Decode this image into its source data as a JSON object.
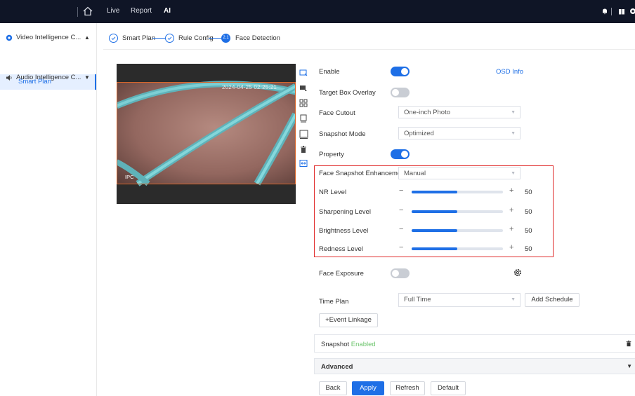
{
  "topbar": {
    "nav": [
      "Live",
      "Report",
      "AI"
    ],
    "active_nav": "AI",
    "icons": [
      "home-icon",
      "bell-icon",
      "gift-icon",
      "settings-icon"
    ]
  },
  "sidebar": {
    "items": [
      {
        "label": "Video Intelligence C...",
        "icon": "video-ai-icon",
        "expanded": true
      },
      {
        "label": "Audio Intelligence C...",
        "icon": "audio-icon",
        "expanded": false
      }
    ],
    "sub_items": [
      {
        "label": "Smart Plan",
        "selected": true
      }
    ]
  },
  "steps": [
    {
      "label": "Smart Plan",
      "state": "done"
    },
    {
      "label": "Rule Config",
      "state": "done"
    },
    {
      "label": "Face Detection",
      "state": "current",
      "number": "2.1"
    }
  ],
  "preview": {
    "timestamp": "2024-04-25 02:25:21",
    "channel_label": "IPC",
    "tools": [
      "rectangle-draw-icon",
      "rectangle-cursor-icon",
      "grid-icon",
      "min-size-icon",
      "max-size-icon",
      "delete-icon",
      "fit-icon"
    ]
  },
  "form": {
    "enable_label": "Enable",
    "enable_on": true,
    "osd_info": "OSD Info",
    "target_box_label": "Target Box Overlay",
    "target_box_on": false,
    "face_cutout_label": "Face Cutout",
    "face_cutout_value": "One-inch Photo",
    "snapshot_mode_label": "Snapshot Mode",
    "snapshot_mode_value": "Optimized",
    "property_label": "Property",
    "property_on": true,
    "enhancement_label": "Face Snapshot Enhancement",
    "enhancement_value": "Manual",
    "sliders": [
      {
        "label": "NR Level",
        "value": "50",
        "fraction": 0.5
      },
      {
        "label": "Sharpening Level",
        "value": "50",
        "fraction": 0.5
      },
      {
        "label": "Brightness Level",
        "value": "50",
        "fraction": 0.5
      },
      {
        "label": "Redness Level",
        "value": "50",
        "fraction": 0.5
      }
    ],
    "face_exposure_label": "Face Exposure",
    "face_exposure_on": false,
    "time_plan_label": "Time Plan",
    "time_plan_value": "Full Time",
    "add_schedule": "Add Schedule",
    "event_linkage": "+Event Linkage",
    "snapshot_label": "Snapshot",
    "snapshot_status": "Enabled",
    "advanced_label": "Advanced"
  },
  "footer": {
    "back": "Back",
    "apply": "Apply",
    "refresh": "Refresh",
    "default": "Default"
  },
  "colors": {
    "accent": "#1e6fe6",
    "topbar": "#0f1526",
    "highlight_border": "#e02b2b",
    "enabled_green": "#6bc46b"
  }
}
